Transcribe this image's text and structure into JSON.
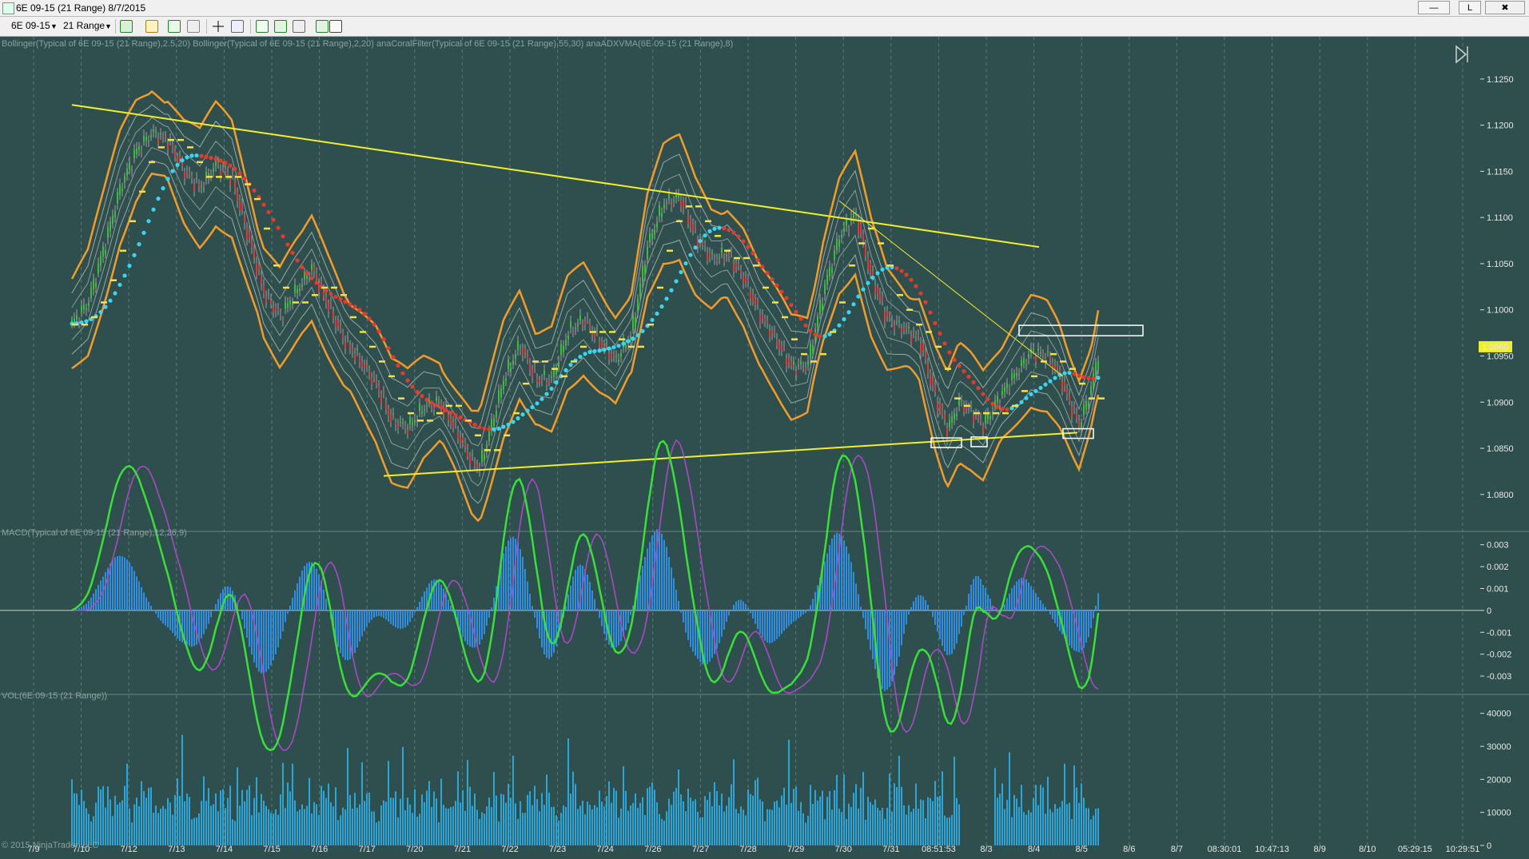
{
  "window": {
    "title": "6E 09-15 (21 Range)  8/7/2015",
    "btn_min": "—",
    "btn_restore": "L",
    "btn_close": "✖"
  },
  "toolbar": {
    "instrument": "6E 09-15",
    "interval": "21 Range"
  },
  "chart_data": {
    "type": "line",
    "instrument": "6E 09-15",
    "period": "21 Range",
    "date": "8/7/2015",
    "price_panel": {
      "label": "Bollinger(Typical of 6E 09-15 (21 Range),2.5,20)  Bollinger(Typical of 6E 09-15 (21 Range),2,20)  anaCoralFilter(Typical of 6E 09-15 (21 Range),55,30)  anaADXVMA(6E 09-15 (21 Range),8)",
      "ylim": [
        1.076,
        1.1275
      ],
      "y_ticks": [
        "1.1250",
        "1.1200",
        "1.1150",
        "1.1100",
        "1.1050",
        "1.1000",
        "1.0950",
        "1.0900",
        "1.0850",
        "1.0800"
      ],
      "last_price": "1.0960",
      "upper_trendline": [
        [
          0,
          1.1222
        ],
        [
          1210,
          1.1068
        ]
      ],
      "lower_trendline": [
        [
          390,
          1.082
        ],
        [
          1258,
          1.0867
        ]
      ],
      "thin_trendline": [
        [
          960,
          1.1118
        ],
        [
          1240,
          1.0928
        ]
      ],
      "support_boxes": [
        [
          1075,
          1.0856
        ],
        [
          1125,
          1.0857
        ],
        [
          1240,
          1.0866
        ]
      ],
      "resistance_box": [
        1185,
        1.0978
      ],
      "typical_price": [
        [
          0,
          1.0985
        ],
        [
          20,
          1.1008
        ],
        [
          40,
          1.1068
        ],
        [
          60,
          1.1132
        ],
        [
          80,
          1.1172
        ],
        [
          100,
          1.1192
        ],
        [
          120,
          1.1183
        ],
        [
          140,
          1.115
        ],
        [
          160,
          1.1132
        ],
        [
          180,
          1.1158
        ],
        [
          200,
          1.1142
        ],
        [
          220,
          1.108
        ],
        [
          240,
          1.1018
        ],
        [
          260,
          1.0992
        ],
        [
          280,
          1.102
        ],
        [
          300,
          1.1045
        ],
        [
          320,
          1.1005
        ],
        [
          340,
          1.0968
        ],
        [
          360,
          1.0945
        ],
        [
          380,
          1.092
        ],
        [
          400,
          1.088
        ],
        [
          420,
          1.0872
        ],
        [
          440,
          1.0895
        ],
        [
          460,
          1.09
        ],
        [
          480,
          1.087
        ],
        [
          500,
          1.0835
        ],
        [
          510,
          1.083
        ],
        [
          520,
          1.086
        ],
        [
          540,
          1.0925
        ],
        [
          560,
          1.0962
        ],
        [
          580,
          1.0925
        ],
        [
          600,
          1.0925
        ],
        [
          620,
          1.0975
        ],
        [
          640,
          1.099
        ],
        [
          660,
          1.0965
        ],
        [
          680,
          1.0945
        ],
        [
          700,
          1.0975
        ],
        [
          720,
          1.107
        ],
        [
          740,
          1.1115
        ],
        [
          760,
          1.1122
        ],
        [
          780,
          1.108
        ],
        [
          800,
          1.1055
        ],
        [
          820,
          1.106
        ],
        [
          840,
          1.1035
        ],
        [
          860,
          1.0995
        ],
        [
          880,
          1.0968
        ],
        [
          900,
          1.0938
        ],
        [
          920,
          1.094
        ],
        [
          940,
          1.102
        ],
        [
          960,
          1.108
        ],
        [
          980,
          1.1105
        ],
        [
          1000,
          1.1035
        ],
        [
          1020,
          1.099
        ],
        [
          1040,
          1.098
        ],
        [
          1060,
          1.0968
        ],
        [
          1080,
          1.0905
        ],
        [
          1095,
          1.087
        ],
        [
          1110,
          1.09
        ],
        [
          1125,
          1.089
        ],
        [
          1140,
          1.0875
        ],
        [
          1160,
          1.0905
        ],
        [
          1180,
          1.093
        ],
        [
          1200,
          1.0955
        ],
        [
          1220,
          1.095
        ],
        [
          1235,
          1.093
        ],
        [
          1250,
          1.0895
        ],
        [
          1260,
          1.0875
        ],
        [
          1275,
          1.0915
        ],
        [
          1285,
          1.0958
        ]
      ]
    },
    "macd_panel": {
      "label": "MACD(Typical of 6E 09-15 (21 Range),12,26,9)",
      "ylim": [
        -0.0038,
        0.0035
      ],
      "y_ticks": [
        "0.003",
        "0.002",
        "0.001",
        "0",
        "-0.001",
        "-0.002",
        "-0.003"
      ]
    },
    "volume_panel": {
      "label": "VOL(6E 09-15 (21 Range))",
      "ylim": [
        0,
        45000
      ],
      "y_ticks": [
        "40000",
        "30000",
        "20000",
        "10000",
        "0"
      ]
    },
    "x_labels": [
      "7/9",
      "7/10",
      "7/12",
      "7/13",
      "7/14",
      "7/15",
      "7/16",
      "7/17",
      "7/20",
      "7/21",
      "7/22",
      "7/23",
      "7/24",
      "7/26",
      "7/27",
      "7/28",
      "7/29",
      "7/30",
      "7/31",
      "08:51:53",
      "8/3",
      "8/4",
      "8/5",
      "8/6",
      "8/7",
      "08:30:01",
      "10:47:13",
      "8/9",
      "8/10",
      "05:29:15",
      "10:29:51"
    ],
    "copyright": "© 2015 NinjaTrader, LLC"
  }
}
